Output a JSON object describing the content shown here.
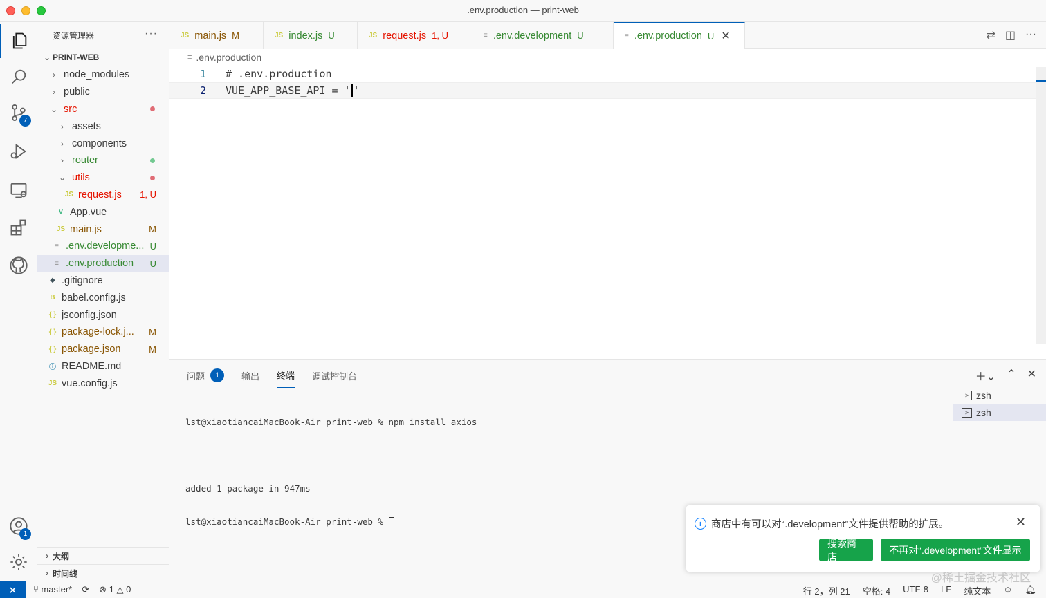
{
  "window": {
    "title": ".env.production — print-web"
  },
  "activity": {
    "scm_badge": "7",
    "accounts_badge": "1"
  },
  "sidebar": {
    "header": "资源管理器",
    "more": "···",
    "project": "PRINT-WEB",
    "items": [
      {
        "name": "node_modules",
        "chevron": "›",
        "icon": "",
        "status": "",
        "color": "normal"
      },
      {
        "name": "public",
        "chevron": "›",
        "icon": "",
        "status": "",
        "color": "normal"
      },
      {
        "name": "src",
        "chevron": "⌄",
        "icon": "",
        "status": "dot",
        "color": "err"
      },
      {
        "name": "assets",
        "chevron": "›",
        "icon": "",
        "status": "",
        "color": "normal"
      },
      {
        "name": "components",
        "chevron": "›",
        "icon": "",
        "status": "",
        "color": "normal"
      },
      {
        "name": "router",
        "chevron": "›",
        "icon": "",
        "status": "dot-green",
        "color": "unt"
      },
      {
        "name": "utils",
        "chevron": "⌄",
        "icon": "",
        "status": "dot",
        "color": "err"
      },
      {
        "name": "request.js",
        "chevron": "",
        "icon": "JS",
        "status": "1, U",
        "color": "err"
      },
      {
        "name": "App.vue",
        "chevron": "",
        "icon": "V",
        "status": "",
        "color": "normal"
      },
      {
        "name": "main.js",
        "chevron": "",
        "icon": "JS",
        "status": "M",
        "color": "mod"
      },
      {
        "name": ".env.developme...",
        "chevron": "",
        "icon": "≡",
        "status": "U",
        "color": "unt"
      },
      {
        "name": ".env.production",
        "chevron": "",
        "icon": "≡",
        "status": "U",
        "color": "unt"
      },
      {
        "name": ".gitignore",
        "chevron": "",
        "icon": "◆",
        "status": "",
        "color": "normal"
      },
      {
        "name": "babel.config.js",
        "chevron": "",
        "icon": "B",
        "status": "",
        "color": "normal"
      },
      {
        "name": "jsconfig.json",
        "chevron": "",
        "icon": "{ }",
        "status": "",
        "color": "normal"
      },
      {
        "name": "package-lock.j...",
        "chevron": "",
        "icon": "{ }",
        "status": "M",
        "color": "mod"
      },
      {
        "name": "package.json",
        "chevron": "",
        "icon": "{ }",
        "status": "M",
        "color": "mod"
      },
      {
        "name": "README.md",
        "chevron": "",
        "icon": "ⓘ",
        "status": "",
        "color": "normal"
      },
      {
        "name": "vue.config.js",
        "chevron": "",
        "icon": "JS",
        "status": "",
        "color": "normal"
      }
    ],
    "outline": "大纲",
    "timeline": "时间线"
  },
  "tabs": [
    {
      "icon": "JS",
      "label": "main.js",
      "badge": "M",
      "color": "mod"
    },
    {
      "icon": "JS",
      "label": "index.js",
      "badge": "U",
      "color": "unt"
    },
    {
      "icon": "JS",
      "label": "request.js",
      "badge": "1, U",
      "color": "err"
    },
    {
      "icon": "≡",
      "label": ".env.development",
      "badge": "U",
      "color": "unt"
    },
    {
      "icon": "≡",
      "label": ".env.production",
      "badge": "U",
      "color": "unt",
      "active": true
    }
  ],
  "editor": {
    "breadcrumb": ".env.production",
    "lines": [
      {
        "num": "1",
        "text": "# .env.production"
      },
      {
        "num": "2",
        "text_before": "VUE_APP_BASE_API = '",
        "text_after": "'"
      }
    ]
  },
  "panel": {
    "tabs": [
      "问题",
      "输出",
      "终端",
      "调试控制台"
    ],
    "problems_count": "1",
    "terminal_lines": [
      "lst@xiaotiancaiMacBook-Air print-web % npm install axios",
      "",
      "added 1 package in 947ms",
      "lst@xiaotiancaiMacBook-Air print-web % "
    ],
    "terminals": [
      "zsh",
      "zsh"
    ]
  },
  "notification": {
    "message": "商店中有可以对“.development”文件提供帮助的扩展。",
    "button_search": "搜索商店",
    "button_hide": "不再对“.development”文件显示"
  },
  "statusbar": {
    "branch": "master*",
    "errors": "1",
    "warnings": "0",
    "position": "行 2，列 21",
    "spaces": "空格: 4",
    "encoding": "UTF-8",
    "eol": "LF",
    "language": "纯文本"
  },
  "watermark": "@稀土掘金技术社区",
  "colors": {
    "accent": "#005fb8",
    "modified": "#895503",
    "untracked": "#388a34",
    "error": "#e51400",
    "button": "#16a34a"
  }
}
